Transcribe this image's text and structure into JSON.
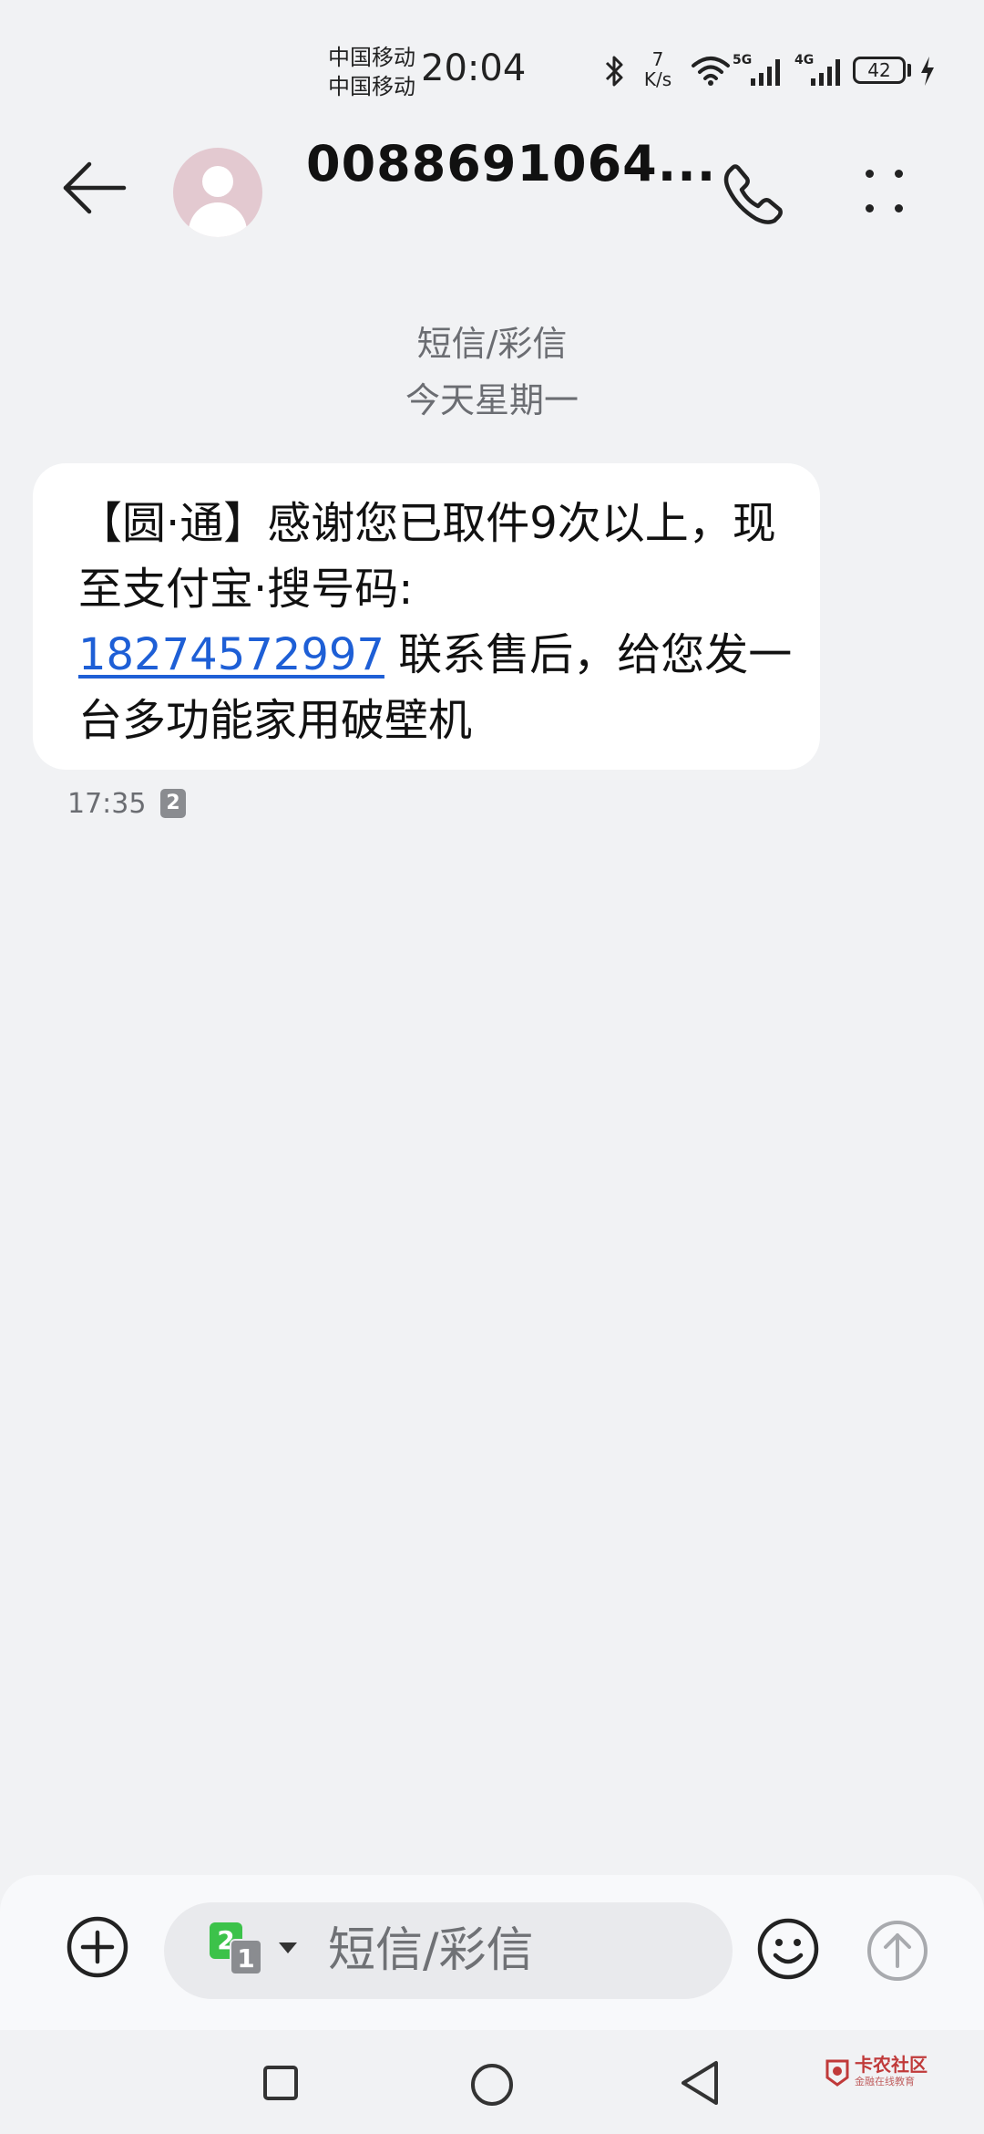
{
  "status_bar": {
    "carrier_1": "中国移动",
    "carrier_2": "中国移动",
    "time": "20:04",
    "speed_value": "7",
    "speed_unit": "K/s",
    "network_1": "5G",
    "network_2": "4G",
    "battery": "42",
    "icons": [
      "bluetooth-icon",
      "wifi-icon",
      "signal-icon",
      "signal-icon",
      "battery-icon",
      "charging-icon"
    ]
  },
  "header": {
    "contact": "0088691064..."
  },
  "conversation": {
    "type_label": "短信/彩信",
    "date_label": "今天星期一",
    "messages": [
      {
        "text_before": "【圆·通】感谢您已取件9次以上，现至支付宝·搜号码:",
        "phone": "18274572997",
        "text_after": " 联系售后，给您发一台多功能家用破壁机",
        "time": "17:35",
        "sim": "2"
      }
    ]
  },
  "composer": {
    "placeholder": "短信/彩信",
    "sim_primary": "2",
    "sim_secondary": "1"
  },
  "watermark": {
    "title": "卡农社区",
    "subtitle": "金融在线教育"
  },
  "colors": {
    "background": "#f1f2f4",
    "link": "#1e5fd6",
    "sim_green": "#3cc24a",
    "avatar": "#e3c9d0"
  }
}
